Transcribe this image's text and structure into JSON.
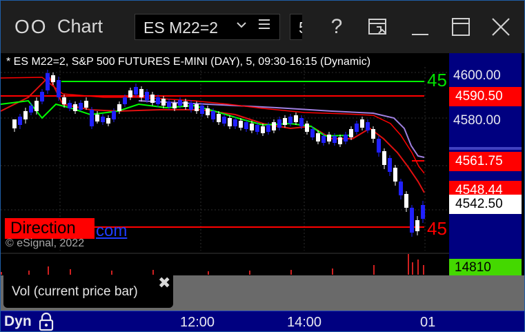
{
  "titlebar": {
    "pane_icon": "OO",
    "title": "Chart",
    "symbol": "ES M22=2",
    "symbol_dropdown_icon": "chevron-down-icon",
    "symbol_menu_icon": "hamburger-icon",
    "second_symbol_partial": "5",
    "help_label": "?",
    "buttons": [
      "help-icon",
      "export-icon",
      "minimize-icon",
      "maximize-icon",
      "close-icon"
    ]
  },
  "chart": {
    "header": "* ES M22=2, S&P 500 FUTURES E-MINI (DAY), 5, 09:30-16:15 (Dynamic)",
    "price_labels": [
      "4600.00",
      "4580.00"
    ],
    "price_boxes": [
      {
        "text": "4590.50",
        "bg": "#ff0000",
        "fg": "#ffffff"
      },
      {
        "text": "4561.75",
        "bg": "#ff0000",
        "fg": "#ffffff"
      },
      {
        "text": "4548.44",
        "bg": "#ff0000",
        "fg": "#ffffff"
      },
      {
        "text": "4542.50",
        "bg": "#ffffff",
        "fg": "#000000"
      }
    ],
    "green_level_label": "45",
    "red_level_label": "45",
    "direction_label": "Direction",
    "link_text": "com",
    "copyright": "© eSignal, 2022",
    "colors": {
      "up_candle": "#ffffff",
      "down_candle": "#2020ff",
      "red_line": "#ff0000",
      "green_line": "#00ff00",
      "purple_line": "#a080e0",
      "dark_red_line": "#c00000"
    }
  },
  "volume": {
    "value": "14810",
    "panel_label": "Vol (current price bar)",
    "close_icon": "✖"
  },
  "time_axis": {
    "mode": "Dyn",
    "labels": [
      "12:00",
      "14:00",
      "01"
    ]
  }
}
